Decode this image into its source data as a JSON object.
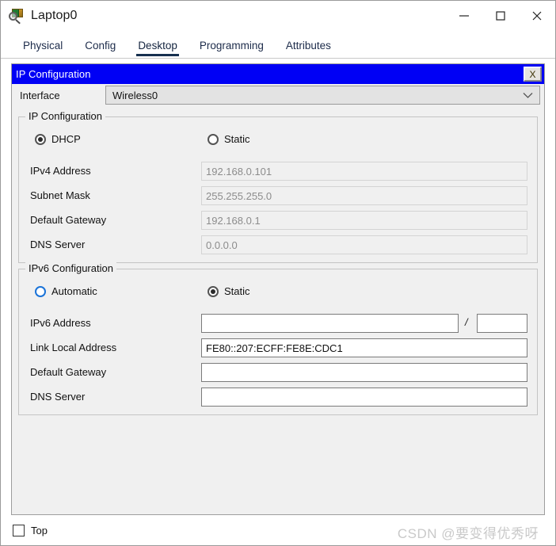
{
  "window": {
    "title": "Laptop0",
    "icon": "packet-tracer-laptop-icon",
    "controls": {
      "minimize": "minimize-icon",
      "maximize": "maximize-icon",
      "close": "close-icon"
    }
  },
  "tabs": [
    {
      "label": "Physical",
      "active": false
    },
    {
      "label": "Config",
      "active": false
    },
    {
      "label": "Desktop",
      "active": true
    },
    {
      "label": "Programming",
      "active": false
    },
    {
      "label": "Attributes",
      "active": false
    }
  ],
  "dialog": {
    "title": "IP Configuration",
    "close_label": "X",
    "accent_color": "#0000f5"
  },
  "interface": {
    "label": "Interface",
    "value": "Wireless0",
    "arrow_icon": "chevron-down-icon"
  },
  "ipv4": {
    "group_title": "IP Configuration",
    "mode_options": [
      {
        "label": "DHCP",
        "selected": true
      },
      {
        "label": "Static",
        "selected": false
      }
    ],
    "fields": [
      {
        "label": "IPv4 Address",
        "value": "192.168.0.101",
        "disabled": true
      },
      {
        "label": "Subnet Mask",
        "value": "255.255.255.0",
        "disabled": true
      },
      {
        "label": "Default Gateway",
        "value": "192.168.0.1",
        "disabled": true
      },
      {
        "label": "DNS Server",
        "value": "0.0.0.0",
        "disabled": true
      }
    ]
  },
  "ipv6": {
    "group_title": "IPv6 Configuration",
    "mode_options": [
      {
        "label": "Automatic",
        "selected": false,
        "highlighted": true
      },
      {
        "label": "Static",
        "selected": true,
        "highlighted": false
      }
    ],
    "address_row": {
      "label": "IPv6 Address",
      "value": "",
      "separator": "/",
      "prefix_value": ""
    },
    "fields": [
      {
        "label": "Link Local Address",
        "value": "FE80::207:ECFF:FE8E:CDC1",
        "disabled": false
      },
      {
        "label": "Default Gateway",
        "value": "",
        "disabled": false
      },
      {
        "label": "DNS Server",
        "value": "",
        "disabled": false
      }
    ]
  },
  "footer": {
    "top_checkbox_label": "Top",
    "top_checkbox_checked": false,
    "watermark": "CSDN @要变得优秀呀"
  }
}
